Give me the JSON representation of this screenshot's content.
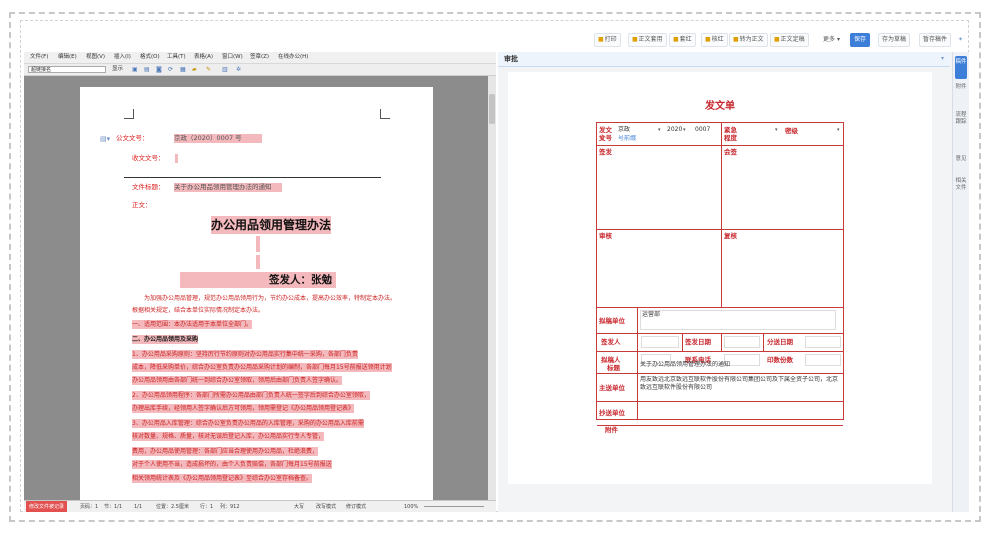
{
  "toolbar": {
    "items": [
      "打印",
      "正文套用",
      "套红",
      "核红",
      "转为正文",
      "正文定稿",
      "更多",
      "保存",
      "存为草稿",
      "暂存稿件"
    ]
  },
  "editor": {
    "menu": [
      "文件(F)",
      "编辑(E)",
      "视图(V)",
      "插入(I)",
      "格式(O)",
      "工具(T)",
      "表格(A)",
      "窗口(W)",
      "签章(Z)",
      "在线办公(H)"
    ],
    "style_value": "超链接名",
    "display_label": "显示",
    "fields": {
      "doc_no_label": "公文文号：",
      "doc_no_value": "京政（2020）0007 号",
      "receipt_label": "收文文号：",
      "main_send_label": "文件标题：",
      "main_send_value": "关于办公用品领用管理办法的通知",
      "body_label": "正文："
    },
    "title": "办公用品领用管理办法",
    "signer": "签发人：张勉",
    "paragraphs": [
      "为加强办公用品管理，规范办公用品领用行为，节约办公成本，提高办公效率，特制定本办法。",
      "根据相关规定，结合本单位实际情况制定本办法。",
      "一、适用范围：本办法适用于本单位全部门。",
      "二、办公用品领用及采购",
      "1、办公用品采购原则：坚持厉行节约原则对办公用品实行集中统一采购，各部门负责",
      "成本，降低采购单价，综合办公室负责办公用品采购计划的编制，各部门每月15号前报送领用计划",
      "办公用品领用由各部门统一到综合办公室领取，领用后由部门负责人签字确认。",
      "2、办公用品领用程序：各部门所需办公用品由部门负责人统一签字后到综合办公室领取，",
      "办理出库手续，经领用人签字确认后方可领用，领用需登记《办公用品领用登记表》",
      "3、办公用品入库管理：综合办公室负责办公用品的入库管理，采购的办公用品入库前需",
      "核对数量、规格、质量，核对无误后登记入库，办公用品实行专人专管，",
      "费用，办公用品使用管理：各部门应当合理使用办公用品，杜绝浪费，",
      "对于个人使用不当，造成损坏的，由个人负责赔偿，各部门每月15号前报送",
      "相关领用统计表及《办公用品领用登记表》至综合办公室存档备查。"
    ],
    "status": {
      "badge": "修改文件被记录",
      "page": "页码：1",
      "section": "节：1/1",
      "pos": "1/1",
      "line": "位置：2.5厘米",
      "row": "行：1",
      "col": "列：912",
      "zoom_label": "100%",
      "modes": [
        "大写",
        "改写模式",
        "修订模式"
      ]
    }
  },
  "panel": {
    "header": "审批",
    "tabs": [
      "稿件",
      "附件",
      "流程跟踪",
      "意见",
      "相关文件"
    ],
    "form": {
      "title": "发文单",
      "labels": {
        "doc_no": "发文\n文号",
        "urgency": "紧急\n程度",
        "secret": "密级",
        "sign": "签发",
        "countersign": "会签",
        "review": "审核",
        "recheck": "复核",
        "draft_unit": "拟稿单位",
        "issuer": "签发人",
        "issue_date": "签发日期",
        "print_date": "分送日期",
        "drafter": "拟稿人",
        "phone": "联系电话",
        "copies": "印数份数",
        "subject": "标题",
        "main_send": "主送单位",
        "cc_send": "抄送单位",
        "attach": "附件"
      },
      "values": {
        "doc_prefix": "京政",
        "doc_year": "2020",
        "doc_num": "0007",
        "doc_suffix": "号",
        "doc_link": "号前缀",
        "draft_unit": "运营部",
        "subject": "关于办公用品领用管理办法的通知",
        "main_send": "用友致远北京致远互联软件股份有限公司集团公司及下属全资子公司，北京致远互联软件股份有限公司"
      }
    }
  }
}
